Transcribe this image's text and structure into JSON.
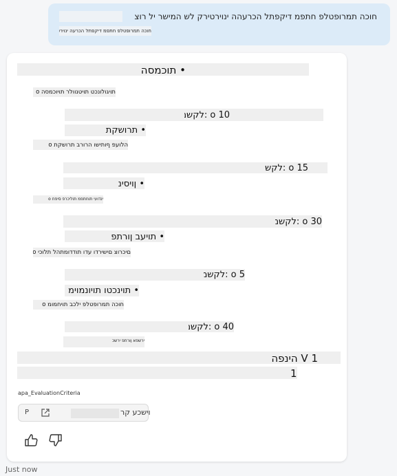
{
  "user_message": {
    "line1": "חוכה תמרופטלפ חתפמ דיקפתל הכרעהה ינוירטירק לש המישר יל רוצ",
    "line2": "חוכה תמרופטלפ חתפמ דיקפתל הכרעה ינוירטירק"
  },
  "response": {
    "section1": {
      "title": "• תוכמסה",
      "bullet": "תויגולונכט תויטנוולר תויוכמסה o"
    },
    "weight1": "o 10 :לקשמ",
    "section2": {
      "title": "• תרושקת",
      "bullet": "הלועפ ףותישו הרורב תרושקת o"
    },
    "weight2": "o 15 :לקשמ",
    "section3": {
      "title": "• ןויסינ",
      "bullet": "ינדועי תוחתפמ תוליכרפ סיפח o"
    },
    "weight3": "o 30 :לקשמ",
    "section4": {
      "title": "• תויעב ןורתפ",
      "bullet": "םיכרוצ םישירדו עדו תודדומתהל תלוכי o"
    },
    "weight4": "o 5 :לקשמ",
    "section5": {
      "title": "• תוינכטו תויונמוימ",
      "bullet": "חוכה תמרופטלפ ילכב תויחמומ o"
    },
    "weight5": "o 40 :לקשמ",
    "section6_line": "ירשפא ןורתפ ירשכ",
    "version_line": "V 1 הינפה",
    "version_number": "1",
    "citation_label": "apa_EvaluationCriteria"
  },
  "source_chip": {
    "prefix": "P",
    "label": "וישכע קר"
  },
  "feedback": {
    "like_icon": "thumbs-up-icon",
    "dislike_icon": "thumbs-down-icon"
  },
  "timestamp": "Just now"
}
